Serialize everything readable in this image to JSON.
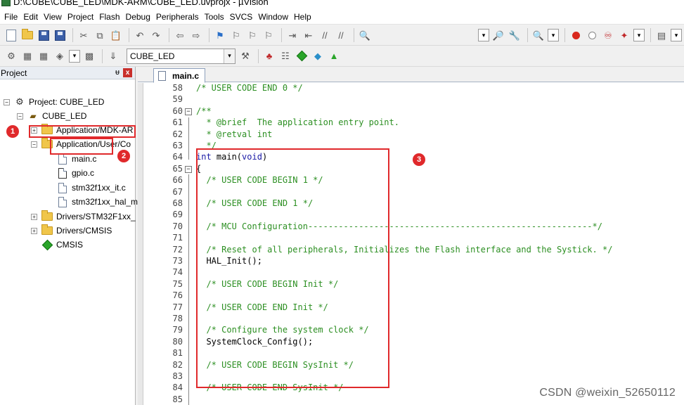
{
  "window": {
    "title": "D:\\CUBE\\CUBE_LED\\MDK-ARM\\CUBE_LED.uvprojx - µVision"
  },
  "menu": [
    "File",
    "Edit",
    "View",
    "Project",
    "Flash",
    "Debug",
    "Peripherals",
    "Tools",
    "SVCS",
    "Window",
    "Help"
  ],
  "toolbar2": {
    "target": "CUBE_LED"
  },
  "project_panel": {
    "title": "Project",
    "pin_glyph": "ᵾ",
    "close_glyph": "x",
    "tree": [
      {
        "label": "Project: CUBE_LED",
        "expander": "−"
      },
      {
        "label": "CUBE_LED",
        "expander": "−"
      },
      {
        "label": "Application/MDK-AR",
        "expander": "+"
      },
      {
        "label": "Application/User/Co",
        "expander": "−"
      },
      {
        "label": "main.c"
      },
      {
        "label": "gpio.c"
      },
      {
        "label": "stm32f1xx_it.c"
      },
      {
        "label": "stm32f1xx_hal_m"
      },
      {
        "label": "Drivers/STM32F1xx_",
        "expander": "+"
      },
      {
        "label": "Drivers/CMSIS",
        "expander": "+"
      },
      {
        "label": "CMSIS"
      }
    ]
  },
  "annotations": [
    "1",
    "2",
    "3"
  ],
  "editor": {
    "tab": "main.c",
    "fold_glyph": "−",
    "lines": [
      {
        "n": "58",
        "text": "/* USER CODE END 0 */",
        "kind": "com"
      },
      {
        "n": "59",
        "text": "",
        "kind": "com"
      },
      {
        "n": "60",
        "text": "/**",
        "kind": "com",
        "fold": true
      },
      {
        "n": "61",
        "text": "  * @brief  The application entry point.",
        "kind": "com"
      },
      {
        "n": "62",
        "text": "  * @retval int",
        "kind": "com"
      },
      {
        "n": "63",
        "text": "  */",
        "kind": "com"
      },
      {
        "n": "64",
        "pre": "int",
        "text": " main(",
        "kw2": "void",
        "post": ")",
        "kind": "sig"
      },
      {
        "n": "65",
        "text": "{",
        "kind": "plain",
        "fold": true
      },
      {
        "n": "66",
        "text": "  /* USER CODE BEGIN 1 */",
        "kind": "com"
      },
      {
        "n": "67",
        "text": "",
        "kind": "com"
      },
      {
        "n": "68",
        "text": "  /* USER CODE END 1 */",
        "kind": "com"
      },
      {
        "n": "69",
        "text": "",
        "kind": "com"
      },
      {
        "n": "70",
        "text": "  /* MCU Configuration--------------------------------------------------------*/",
        "kind": "com"
      },
      {
        "n": "71",
        "text": "",
        "kind": "com"
      },
      {
        "n": "72",
        "text": "  /* Reset of all peripherals, Initializes the Flash interface and the Systick. */",
        "kind": "com"
      },
      {
        "n": "73",
        "text": "  HAL_Init();",
        "kind": "plain"
      },
      {
        "n": "74",
        "text": "",
        "kind": "plain"
      },
      {
        "n": "75",
        "text": "  /* USER CODE BEGIN Init */",
        "kind": "com"
      },
      {
        "n": "76",
        "text": "",
        "kind": "com"
      },
      {
        "n": "77",
        "text": "  /* USER CODE END Init */",
        "kind": "com"
      },
      {
        "n": "78",
        "text": "",
        "kind": "com"
      },
      {
        "n": "79",
        "text": "  /* Configure the system clock */",
        "kind": "com"
      },
      {
        "n": "80",
        "text": "  SystemClock_Config();",
        "kind": "plain"
      },
      {
        "n": "81",
        "text": "",
        "kind": "plain"
      },
      {
        "n": "82",
        "text": "  /* USER CODE BEGIN SysInit */",
        "kind": "com"
      },
      {
        "n": "83",
        "text": "",
        "kind": "com"
      },
      {
        "n": "84",
        "text": "  /* USER CODE END SysInit */",
        "kind": "com"
      },
      {
        "n": "85",
        "text": "",
        "kind": "com"
      }
    ]
  },
  "watermark": "CSDN @weixin_52650112",
  "colors": {
    "annotation": "#e0292b",
    "comment": "#2c8f22",
    "keyword": "#1a1aa6"
  }
}
